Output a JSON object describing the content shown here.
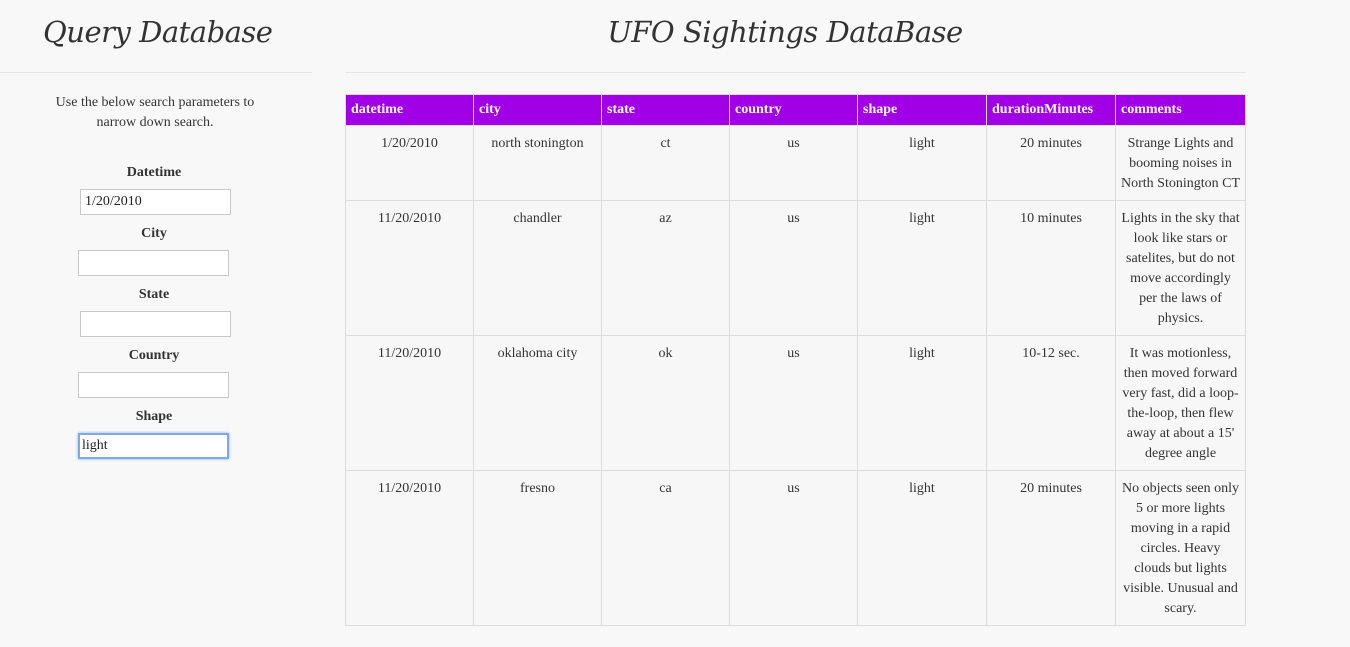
{
  "sidebar": {
    "title": "Query Database",
    "instructions": "Use the below search parameters to narrow down search.",
    "filters": [
      {
        "label": "Datetime",
        "value": "1/20/2010"
      },
      {
        "label": "City",
        "value": ""
      },
      {
        "label": "State",
        "value": ""
      },
      {
        "label": "Country",
        "value": ""
      },
      {
        "label": "Shape",
        "value": "light"
      }
    ]
  },
  "main": {
    "title": "UFO Sightings DataBase",
    "table": {
      "headers": [
        "datetime",
        "city",
        "state",
        "country",
        "shape",
        "durationMinutes",
        "comments"
      ],
      "rows": [
        [
          "1/20/2010",
          "north stonington",
          "ct",
          "us",
          "light",
          "20 minutes",
          "Strange Lights and booming noises in North Stonington CT"
        ],
        [
          "11/20/2010",
          "chandler",
          "az",
          "us",
          "light",
          "10 minutes",
          "Lights in the sky that look like stars or satelites, but do not move accordingly per the laws of physics."
        ],
        [
          "11/20/2010",
          "oklahoma city",
          "ok",
          "us",
          "light",
          "10-12 sec.",
          "It was motionless, then moved forward very fast, did a loop-the-loop, then flew away at about a 15' degree angle"
        ],
        [
          "11/20/2010",
          "fresno",
          "ca",
          "us",
          "light",
          "20 minutes",
          "No objects seen only 5 or more lights moving in a rapid circles. Heavy clouds but lights visible. Unusual and scary."
        ]
      ]
    }
  },
  "colors": {
    "header_bg": "#a100e6",
    "header_text": "#ffffff",
    "focus_ring": "#7fa8e6"
  }
}
